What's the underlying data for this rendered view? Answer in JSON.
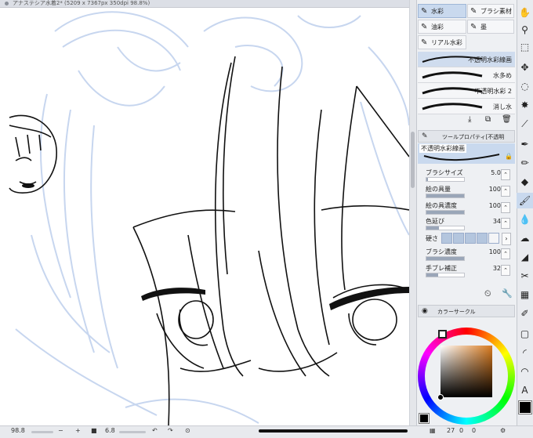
{
  "canvas": {
    "tab_title": "アナステシア水着2* (5209 x 7367px 350dpi 98.8%)"
  },
  "subtools": [
    {
      "label": "水彩",
      "icon": "brush-icon",
      "selected": true
    },
    {
      "label": "ブラシ素材",
      "icon": "brush-material-icon",
      "selected": false
    },
    {
      "label": "油彩",
      "icon": "oil-brush-icon",
      "selected": false
    },
    {
      "label": "墨",
      "icon": "ink-icon",
      "selected": false
    },
    {
      "label": "リアル水彩",
      "icon": "real-watercolor-icon",
      "selected": false
    }
  ],
  "brushes": [
    {
      "label": "不透明水彩線画",
      "selected": true
    },
    {
      "label": "水多め",
      "selected": false
    },
    {
      "label": "不透明水彩 2",
      "selected": false
    },
    {
      "label": "消し水",
      "selected": false
    }
  ],
  "tool_property": {
    "header": "ツールプロパティ[不透明",
    "brush_name": "不透明水彩線画",
    "props": [
      {
        "label": "ブラシサイズ",
        "value": "5.0",
        "fill": 0.05
      },
      {
        "label": "絵の具量",
        "value": "100",
        "fill": 1.0
      },
      {
        "label": "絵の具濃度",
        "value": "100",
        "fill": 1.0
      },
      {
        "label": "色延び",
        "value": "34",
        "fill": 0.34
      },
      {
        "label": "ブラシ濃度",
        "value": "100",
        "fill": 1.0
      },
      {
        "label": "手ブレ補正",
        "value": "32",
        "fill": 0.32
      }
    ],
    "hardness_label": "硬さ"
  },
  "color": {
    "header": "カラーサークル",
    "current_hex": "#000000",
    "picker_hue_hex": "#d97a1e"
  },
  "bottom": {
    "zoom": "98.8",
    "brush_size_display": "6.8",
    "brush_count": "27",
    "layer_count": "0",
    "page_count": "0"
  },
  "colors": {
    "sketch_blue": "#c7d6ef",
    "selection_blue": "#c9d9ee"
  }
}
